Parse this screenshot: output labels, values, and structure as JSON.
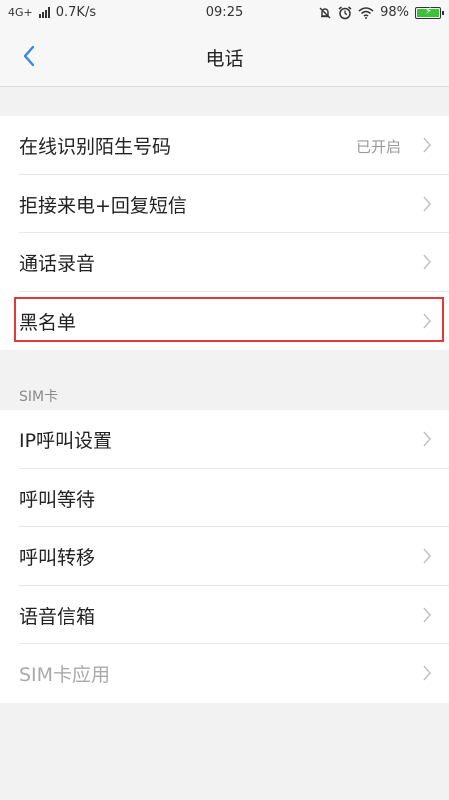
{
  "status_bar": {
    "network": "4G+",
    "speed": "0.7K/s",
    "time": "09:25",
    "battery": "98%",
    "icons": [
      "signal-bars-icon",
      "alarm-off-icon",
      "alarm-clock-icon",
      "wifi-icon",
      "battery-charging-icon"
    ]
  },
  "navbar": {
    "title": "电话",
    "back_icon": "back-chevron-icon"
  },
  "colors": {
    "accent": "#3a86e8",
    "highlight_border": "#e23a3a",
    "battery_fill": "#3cc13b"
  },
  "group1": {
    "items": [
      {
        "label": "在线识别陌生号码",
        "value": "已开启"
      },
      {
        "label": "拒接来电+回复短信"
      },
      {
        "label": "通话录音"
      },
      {
        "label": "黑名单"
      }
    ]
  },
  "sim_section": {
    "header": "SIM卡",
    "items": [
      {
        "label": "IP呼叫设置"
      },
      {
        "label": "呼叫等待"
      },
      {
        "label": "呼叫转移"
      },
      {
        "label": "语音信箱"
      },
      {
        "label": "SIM卡应用"
      }
    ]
  }
}
